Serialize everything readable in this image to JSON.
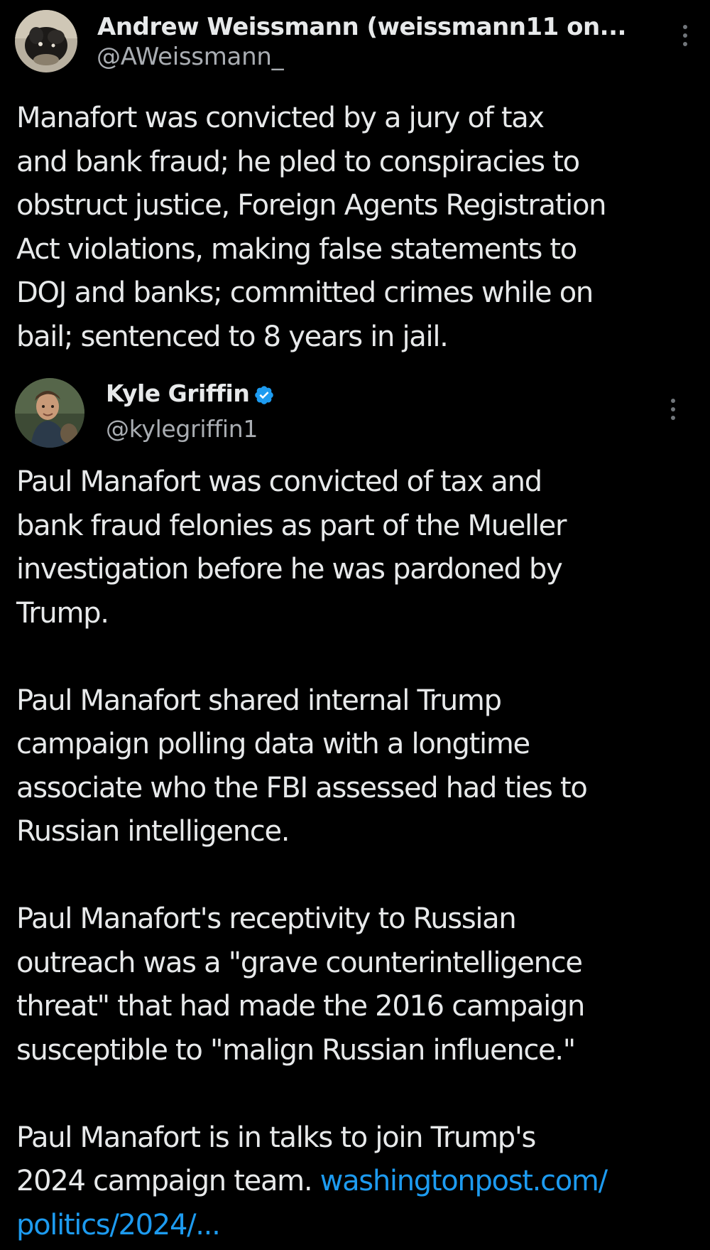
{
  "quoted_tweet": {
    "author": {
      "display_name": "Andrew Weissmann (weissmann11 on...",
      "handle": "@AWeissmann_",
      "avatar_icon": "profile-photo"
    },
    "more_icon": "more-vertical-icon",
    "text": "Manafort was convicted by a jury of tax and bank fraud; he pled to conspiracies to obstruct justice, Foreign Agents Registration Act violations, making false statements to DOJ and banks; committed crimes while on bail; sentenced to 8 years in jail.",
    "text_lines": [
      "Manafort was convicted by a jury of tax",
      "and bank fraud; he pled to conspiracies to",
      "obstruct justice, Foreign Agents Registration",
      "Act violations, making false statements to",
      "DOJ and banks; committed crimes while on",
      "bail; sentenced to 8 years in jail."
    ]
  },
  "main_tweet": {
    "author": {
      "display_name": "Kyle Griffin",
      "handle": "@kylegriffin1",
      "verified": true,
      "verified_icon": "verified-badge-icon",
      "avatar_icon": "profile-photo"
    },
    "more_icon": "more-vertical-icon",
    "paragraphs": [
      {
        "lines": [
          "Paul Manafort was convicted of tax and",
          "bank fraud felonies as part of the Mueller",
          "investigation before he was pardoned by",
          "Trump."
        ]
      },
      {
        "lines": [
          "Paul Manafort shared internal Trump",
          "campaign polling data with a longtime",
          "associate who the FBI assessed had ties to",
          "Russian intelligence."
        ]
      },
      {
        "lines": [
          "Paul Manafort's receptivity to Russian",
          "outreach was a \"grave counterintelligence",
          "threat\" that had made the 2016 campaign",
          "susceptible to \"malign Russian influence.\""
        ]
      },
      {
        "line1": "Paul Manafort is in talks to join Trump's",
        "line2_text": "2024 campaign team. ",
        "link_part1": "washingtonpost.com/",
        "link_part2": "politics/2024/..."
      }
    ]
  },
  "colors": {
    "background": "#000000",
    "text": "#e7e9ea",
    "secondary_text": "#a9adb2",
    "link": "#1d9bf0",
    "verified_badge": "#1d9bf0"
  }
}
